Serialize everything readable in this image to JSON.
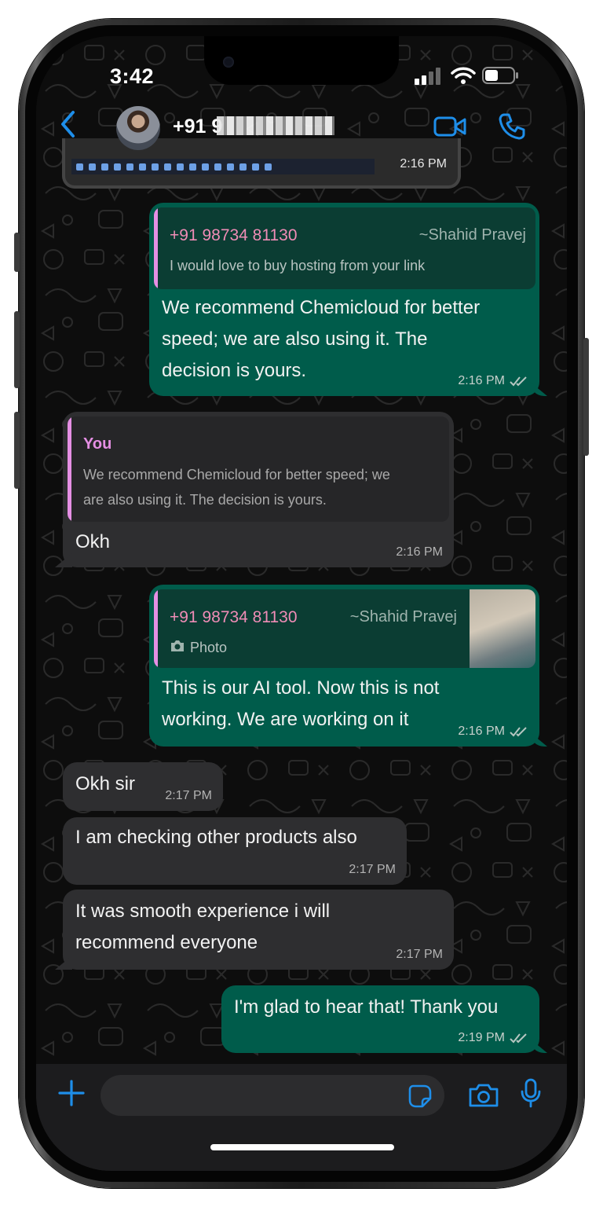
{
  "status_bar": {
    "time": "3:42"
  },
  "header": {
    "contact_name": "+91 9"
  },
  "previous_message": {
    "time": "2:16 PM"
  },
  "messages": [
    {
      "quote": {
        "sender": "+91 98734 81130",
        "author": "~Shahid Pravej",
        "text": "I would love to buy hosting from your link"
      },
      "lines": [
        "We recommend Chemicloud for better",
        "speed; we are also using it. The",
        "decision is yours."
      ],
      "time": "2:16 PM"
    },
    {
      "quote": {
        "sender": "You",
        "lines": [
          "We recommend Chemicloud for better speed; we",
          "are also using it. The decision is yours."
        ]
      },
      "text": "Okh",
      "time": "2:16 PM"
    },
    {
      "quote": {
        "sender": "+91 98734 81130",
        "author": "~Shahid Pravej",
        "text": "Photo"
      },
      "lines": [
        "This is our AI tool. Now this is not",
        "working. We are working on it"
      ],
      "time": "2:16 PM"
    },
    {
      "text": "Okh sir",
      "time": "2:17 PM"
    },
    {
      "text": "I am checking other products also",
      "time": "2:17 PM"
    },
    {
      "lines": [
        "It was smooth experience i will",
        "recommend everyone"
      ],
      "time": "2:17 PM"
    },
    {
      "text": "I'm glad to hear that! Thank you",
      "time": "2:19 PM"
    }
  ],
  "colors": {
    "outgoing_bubble": "#005c4b",
    "incoming_bubble": "#2e2e30",
    "accent": "#1e8ee9",
    "quote_sender": "#ef8cb6"
  },
  "icons": [
    "back-icon",
    "video-call-icon",
    "phone-call-icon",
    "plus-icon",
    "sticker-icon",
    "camera-icon",
    "microphone-icon",
    "double-check-icon",
    "photo-camera-icon"
  ]
}
